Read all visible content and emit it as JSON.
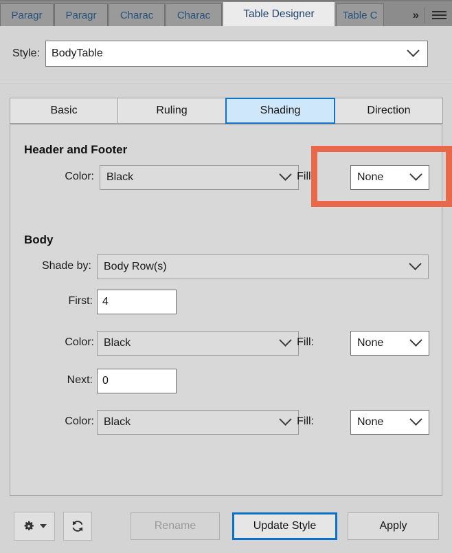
{
  "window": {
    "tabs": [
      {
        "label": "Paragr",
        "name": "tab-paragraph-1",
        "active": false
      },
      {
        "label": "Paragr",
        "name": "tab-paragraph-2",
        "active": false
      },
      {
        "label": "Charac",
        "name": "tab-character-1",
        "active": false
      },
      {
        "label": "Charac",
        "name": "tab-character-2",
        "active": false
      },
      {
        "label": "Table Designer",
        "name": "tab-table-designer",
        "active": true
      },
      {
        "label": "Table C",
        "name": "tab-table-catalog",
        "active": false
      }
    ],
    "overflow_label": "»",
    "menu_icon": "hamburger-menu-icon"
  },
  "style": {
    "label": "Style:",
    "value": "BodyTable",
    "placeholder": "BodyTable"
  },
  "inner_tabs": [
    {
      "label": "Basic",
      "selected": false
    },
    {
      "label": "Ruling",
      "selected": false
    },
    {
      "label": "Shading",
      "selected": true
    },
    {
      "label": "Direction",
      "selected": false
    }
  ],
  "header_footer": {
    "title": "Header and Footer",
    "color_label": "Color:",
    "color_value": "Black",
    "fill_label": "Fill:",
    "fill_value": "None"
  },
  "body": {
    "title": "Body",
    "shade_by_label": "Shade by:",
    "shade_by_value": "Body Row(s)",
    "first_label": "First:",
    "first_value": "4",
    "first_color_label": "Color:",
    "first_color_value": "Black",
    "first_fill_label": "Fill:",
    "first_fill_value": "None",
    "next_label": "Next:",
    "next_value": "0",
    "next_color_label": "Color:",
    "next_color_value": "Black",
    "next_fill_label": "Fill:",
    "next_fill_value": "None"
  },
  "footer_bar": {
    "gear_icon": "gear-icon",
    "refresh_icon": "refresh-icon",
    "rename_label": "Rename",
    "update_label": "Update Style",
    "apply_label": "Apply"
  },
  "annotation": {
    "highlight_color": "#e8694a",
    "target": "header-footer-fill-combo"
  }
}
